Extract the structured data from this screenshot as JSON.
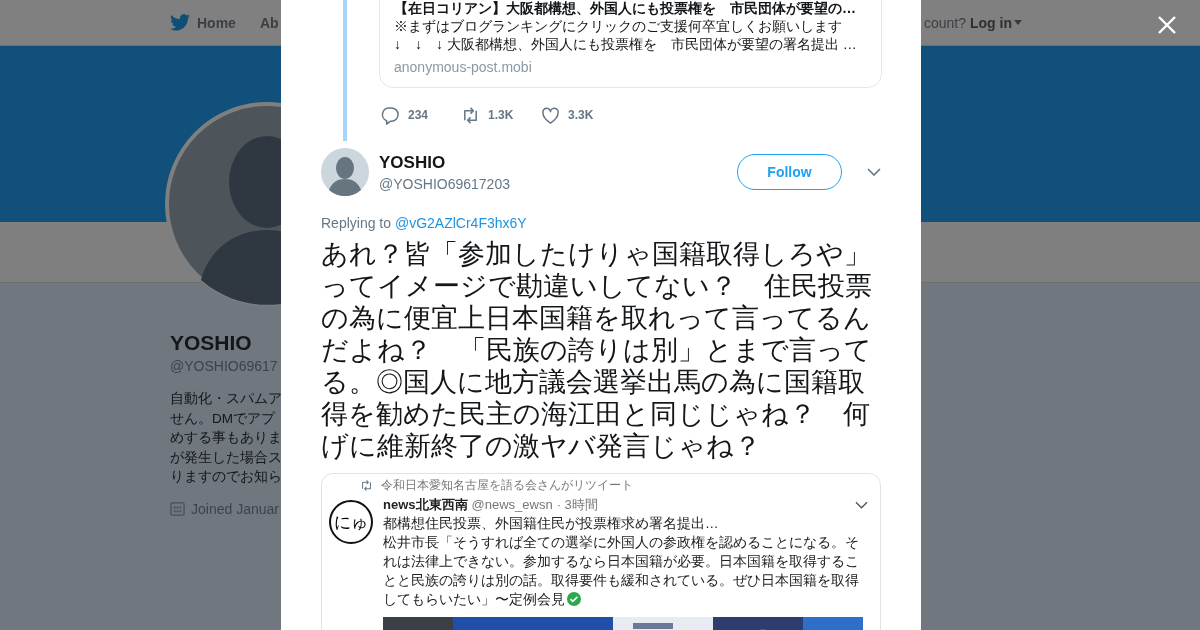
{
  "background_page": {
    "nav": [
      {
        "label": "Home",
        "kind": "home"
      },
      {
        "label": "Ab",
        "kind": "plain"
      }
    ],
    "account_prompt": "count?",
    "login": "Log in",
    "profile": {
      "name": "YOSHIO",
      "handle": "@YOSHIO69617",
      "bio_lines": [
        "自動化・スパムア",
        "せん。DMでアプ",
        "めする事もありま",
        "が発生した場合ス",
        "りますのでお知ら"
      ],
      "joined": "Joined Januar"
    }
  },
  "modal": {
    "quoted_card": {
      "title": "【在日コリアン】大阪都構想、外国人にも投票権を　市民団体が要望の…",
      "description_lines": [
        "※まずはブログランキングにクリックのご支援何卒宜しくお願いします",
        "↓　↓　↓ 大阪都構想、外国人にも投票権を　市民団体が要望の署名提出 …"
      ],
      "domain": "anonymous-post.mobi"
    },
    "actions": [
      {
        "kind": "reply",
        "count": "234"
      },
      {
        "kind": "retweet",
        "count": "1.3K"
      },
      {
        "kind": "like",
        "count": "3.3K"
      }
    ],
    "tweet": {
      "name": "YOSHIO",
      "handle": "@YOSHIO69617203",
      "follow_button": "Follow",
      "replying_label": "Replying to",
      "replying_to": "@vG2AZlCr4F3hx6Y",
      "text": "あれ？皆「参加したけりゃ国籍取得しろや」ってイメージで勘違いしてない？　住民投票の為に便宜上日本国籍を取れって言ってるんだよね？　「民族の誇りは別」とまで言ってる。◎国人に地方議会選挙出馬の為に国籍取得を勧めた民主の海江田と同じじゃね？　何げに維新終了の激ヤバ発言じゃね？",
      "embedded_screenshot": {
        "retweeted_by": "令和日本愛知名古屋を語る会さんがリツイート",
        "avatar_text": "にゅ",
        "name": "news北東西南",
        "handle": "@news_ewsn",
        "time": "· 3時間",
        "headline": "都構想住民投票、外国籍住民が投票権求め署名提出…",
        "body": "松井市長「そうすれば全ての選挙に外国人の参政権を認めることになる。それは法律上できない。参加するなら日本国籍が必要。日本国籍を取得することと民族の誇りは別の話。取得要件も緩和されている。ぜひ日本国籍を取得してもらいたい」〜定例会見",
        "verified": true
      }
    }
  }
}
